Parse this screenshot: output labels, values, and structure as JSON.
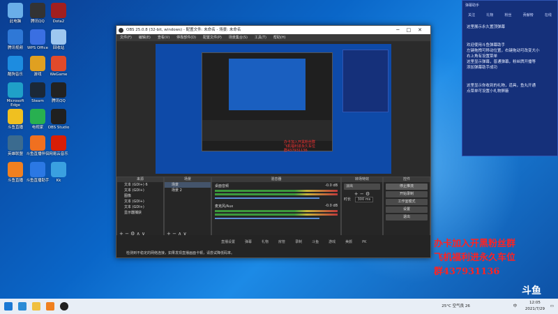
{
  "desktop_icons": [
    {
      "label": "此电脑",
      "color": "#6aaee8"
    },
    {
      "label": "腾讯QQ",
      "color": "#333"
    },
    {
      "label": "Dota2",
      "color": "#a21f1f"
    },
    {
      "label": "腾讯视频",
      "color": "#2f78d6"
    },
    {
      "label": "WPS Office",
      "color": "#3a6fe2"
    },
    {
      "label": "回收站",
      "color": "#9ec7f0"
    },
    {
      "label": "酷狗音乐",
      "color": "#1d8ce0"
    },
    {
      "label": "游戏",
      "color": "#e0a020"
    },
    {
      "label": "WeGame",
      "color": "#e04a2a"
    },
    {
      "label": "Microsoft Edge",
      "color": "#1fa0c8"
    },
    {
      "label": "Steam",
      "color": "#1b2838"
    },
    {
      "label": "腾讯QQ",
      "color": "#222"
    },
    {
      "label": "斗鱼直播",
      "color": "#f0c020"
    },
    {
      "label": "电视家",
      "color": "#28b050"
    },
    {
      "label": "OBS Studio",
      "color": "#202020"
    },
    {
      "label": "英雄联盟",
      "color": "#3b6b8f"
    },
    {
      "label": "斗鱼直播伴侣",
      "color": "#f07020"
    },
    {
      "label": "网易云音乐",
      "color": "#d81e06"
    },
    {
      "label": "斗鱼直播",
      "color": "#f08020"
    },
    {
      "label": "斗鱼直播助手",
      "color": "#2b78e4"
    },
    {
      "label": "Kk",
      "color": "#3aa0e0"
    }
  ],
  "obs": {
    "title": "OBS 25.0.8 (32-bit, windows) - 配置文件: 未命名 - 场景: 未命名",
    "menu": [
      "文件(F)",
      "编辑(E)",
      "查看(V)",
      "停靠部件(D)",
      "配置文件(P)",
      "场景集合(S)",
      "工具(T)",
      "帮助(H)"
    ],
    "scenes_header": "来源",
    "scenes": [
      "文本 (GDI+) 6",
      "文本 (GDI+)",
      "图像",
      "文本 (GDI+)",
      "文本 (GDI+)",
      "显示器捕获"
    ],
    "sources_header": "场景",
    "sources": [
      "场景",
      "场景 2"
    ],
    "mixer_header": "混音器",
    "mixer": [
      {
        "name": "桌面音频",
        "db": "-0.0 dB"
      },
      {
        "name": "麦克风/Aux",
        "db": "-0.0 dB"
      }
    ],
    "transitions_header": "转场特效",
    "transition": "淡出",
    "duration_label": "时长",
    "duration": "300 ms",
    "controls_header": "控件",
    "controls": [
      "停止推流",
      "开始录制",
      "工作室模式",
      "设置",
      "退出"
    ],
    "status": {
      "live": "LIVE: 00:00:00",
      "rec": "REC: 00:00:00",
      "cpu": "CPU: 0.3%, 30.00 fps"
    },
    "notice": "检测到不稳定的网络连接，如果发现直播画面卡顿，请尝试降低码率。",
    "tray_labels": [
      "直播设置",
      "弹幕",
      "礼物",
      "房管",
      "录制",
      "斗鱼",
      "游戏",
      "美颜",
      "PK"
    ]
  },
  "notif": {
    "header": "弹幕助手",
    "tabs": [
      "关注",
      "礼物",
      "粉丝",
      "贡献榜",
      "在线"
    ],
    "messages": [
      "这里展示永久置顶弹幕",
      "欢迎使用斗鱼弹幕助手\n左键拖拽可移动位置，右键拖动可改变大小\n右上角有设置菜单\n这里显示弹幕，普通弹幕，粉丝牌开播等\n添加弹幕助手成功",
      "这里显示你收到的礼物，道具，鱼丸开通\n点菜单可设置小礼物屏蔽"
    ]
  },
  "promo": [
    "办卡加入开黑粉丝群",
    "飞机福利进永久车位",
    "群437931136"
  ],
  "watermark": "斗鱼",
  "taskbar": {
    "weather": "25°C 空气良 26",
    "time": "12:05",
    "date": "2021/7/29",
    "ime": "中"
  }
}
